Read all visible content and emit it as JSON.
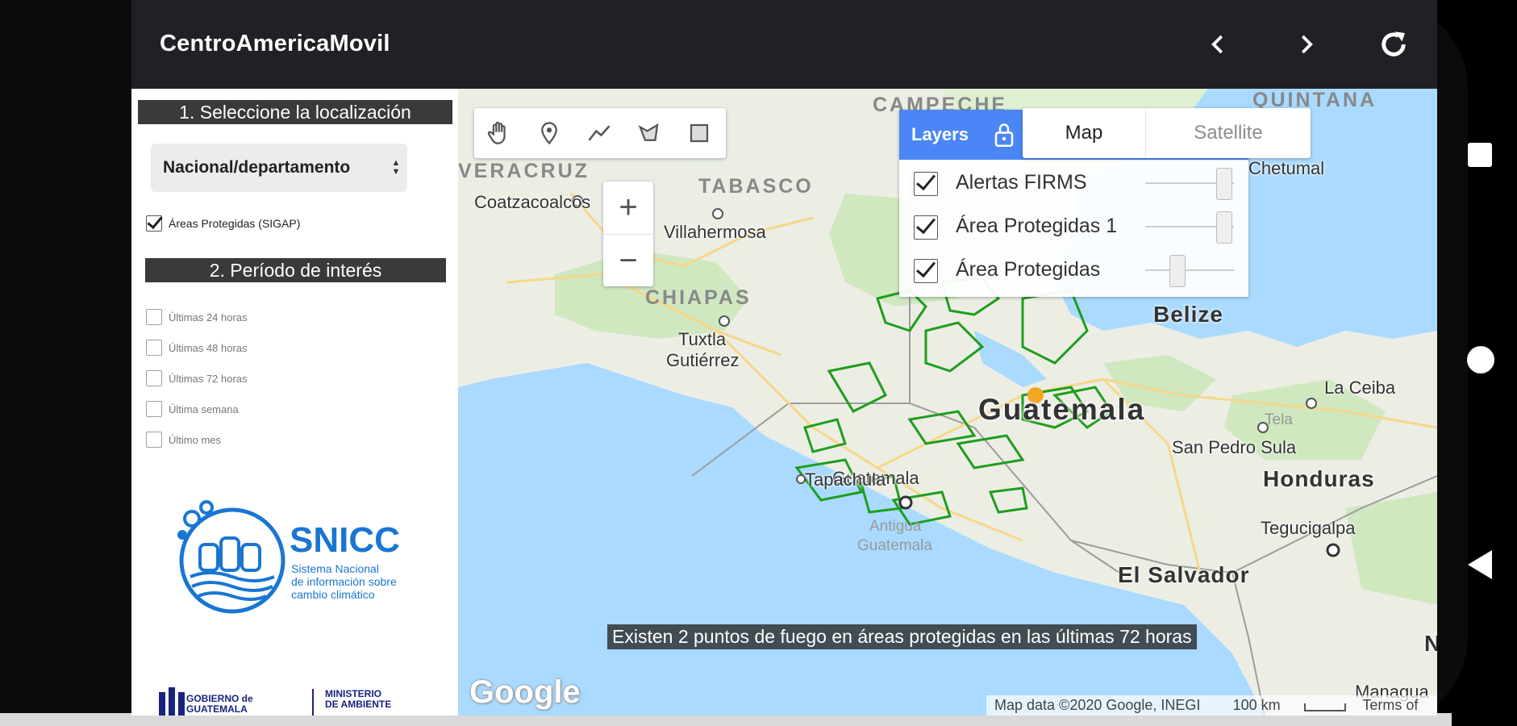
{
  "app": {
    "title": "CentroAmericaMovil"
  },
  "left_panel": {
    "section1": "1. Seleccione la localización",
    "location_select": "Nacional/departamento",
    "protected_areas_label": "Áreas Protegidas (SIGAP)",
    "section2": "2. Período de interés",
    "periods": [
      {
        "label": "Últimas 24 horas",
        "checked": false
      },
      {
        "label": "Últimas 48 horas",
        "checked": false
      },
      {
        "label": "Últimas 72 horas",
        "checked": false
      },
      {
        "label": "Última semana",
        "checked": false
      },
      {
        "label": "Último mes",
        "checked": false
      }
    ],
    "snicc": {
      "title": "SNICC",
      "subtitle_1": "Sistema Nacional",
      "subtitle_2": "de información sobre",
      "subtitle_3": "cambio climático"
    },
    "gov_left_1": "GOBIERNO de",
    "gov_left_2": "GUATEMALA",
    "gov_right_1": "MINISTERIO",
    "gov_right_2": "DE AMBIENTE"
  },
  "map": {
    "layers_title": "Layers",
    "layers": [
      {
        "name": "Alertas FIRMS",
        "checked": true,
        "opacity": 0.9
      },
      {
        "name": "Área Protegidas 1",
        "checked": true,
        "opacity": 0.9
      },
      {
        "name": "Área Protegidas",
        "checked": true,
        "opacity": 0.35
      }
    ],
    "map_type": {
      "map_label": "Map",
      "satellite_label": "Satellite",
      "selected": "Map"
    },
    "labels": {
      "veracruz": "VERACRUZ",
      "coatzacoalcos": "Coatzacoalcos",
      "tabasco": "TABASCO",
      "villahermosa": "Villahermosa",
      "campeche": "CAMPECHE",
      "quintana_roo": "QUINTANA",
      "chetumal": "Chetumal",
      "chiapas": "CHIAPAS",
      "tuxtla1": "Tuxtla",
      "tuxtla2": "Gutiérrez",
      "belize": "Belize",
      "guatemala_country": "Guatemala",
      "guatemala_city": "Guatemala",
      "antigua1": "Antigua",
      "antigua2": "Guatemala",
      "tapachula": "Tapachula",
      "la_ceiba": "La Ceiba",
      "tela": "Tela",
      "san_pedro_sula": "San Pedro Sula",
      "honduras": "Honduras",
      "tegucigalpa": "Tegucigalpa",
      "el_salvador": "El Salvador",
      "nicaragua": "Nicaragu",
      "managua": "Managua"
    },
    "fire_alert": "Existen 2 puntos de fuego en áreas protegidas en las últimas 72 horas",
    "google": "Google",
    "attribution": "Map data ©2020 Google, INEGI",
    "scale": "100 km",
    "terms": "Terms of Use"
  },
  "icons": {
    "back": "chevron-left-icon",
    "forward": "chevron-right-icon",
    "reload": "reload-icon",
    "hand": "hand-icon",
    "marker": "marker-icon",
    "polyline": "polyline-icon",
    "polygon": "polygon-icon",
    "rectangle": "rectangle-icon",
    "lock": "lock-icon",
    "zoom_in": "+",
    "zoom_out": "−"
  },
  "colors": {
    "appbar": "#202124",
    "layers_header": "#4a86f5",
    "snicc_blue": "#1976d2",
    "protected_green": "#1e9e1e",
    "fire_point": "#f5a623"
  }
}
